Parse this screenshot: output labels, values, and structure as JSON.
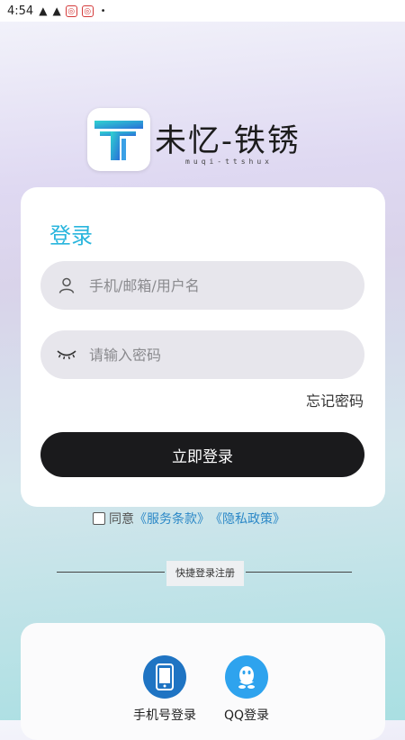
{
  "status_bar": {
    "time": "4:54",
    "icons": [
      "signal-icon",
      "signal-icon",
      "app-badge-icon",
      "app-badge-icon",
      "dot-icon"
    ],
    "dot": "•"
  },
  "brand": {
    "title": "未忆-铁锈",
    "subtitle": "muqi-ttshux"
  },
  "login_card": {
    "title": "登录",
    "username_placeholder": "手机/邮箱/用户名",
    "password_placeholder": "请输入密码",
    "forgot_label": "忘记密码",
    "submit_label": "立即登录"
  },
  "agreement": {
    "prefix": "同意",
    "terms_link": "《服务条款》",
    "privacy_link": "《隐私政策》"
  },
  "quick_login": {
    "divider_label": "快捷登录注册",
    "options": [
      {
        "label": "手机号登录",
        "icon": "phone-icon"
      },
      {
        "label": "QQ登录",
        "icon": "qq-icon"
      }
    ]
  },
  "colors": {
    "accent": "#29b5dd",
    "link": "#2c88c7",
    "button": "#1a1a1c",
    "phone_icon_bg": "#1f74c3",
    "qq_icon_bg": "#2ea3ee"
  }
}
